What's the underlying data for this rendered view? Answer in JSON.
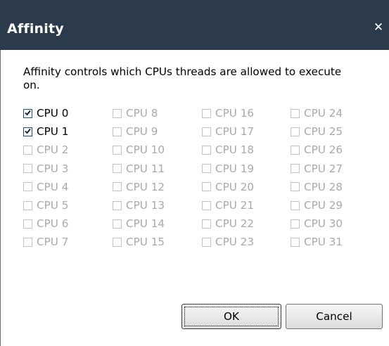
{
  "dialog": {
    "title": "Affinity",
    "close_icon": "close-icon",
    "description": "Affinity controls which CPUs threads are allowed to execute on.",
    "cpus": [
      {
        "label": "CPU 0",
        "checked": true,
        "enabled": true
      },
      {
        "label": "CPU 1",
        "checked": true,
        "enabled": true
      },
      {
        "label": "CPU 2",
        "checked": false,
        "enabled": false
      },
      {
        "label": "CPU 3",
        "checked": false,
        "enabled": false
      },
      {
        "label": "CPU 4",
        "checked": false,
        "enabled": false
      },
      {
        "label": "CPU 5",
        "checked": false,
        "enabled": false
      },
      {
        "label": "CPU 6",
        "checked": false,
        "enabled": false
      },
      {
        "label": "CPU 7",
        "checked": false,
        "enabled": false
      },
      {
        "label": "CPU 8",
        "checked": false,
        "enabled": false
      },
      {
        "label": "CPU 9",
        "checked": false,
        "enabled": false
      },
      {
        "label": "CPU 10",
        "checked": false,
        "enabled": false
      },
      {
        "label": "CPU 11",
        "checked": false,
        "enabled": false
      },
      {
        "label": "CPU 12",
        "checked": false,
        "enabled": false
      },
      {
        "label": "CPU 13",
        "checked": false,
        "enabled": false
      },
      {
        "label": "CPU 14",
        "checked": false,
        "enabled": false
      },
      {
        "label": "CPU 15",
        "checked": false,
        "enabled": false
      },
      {
        "label": "CPU 16",
        "checked": false,
        "enabled": false
      },
      {
        "label": "CPU 17",
        "checked": false,
        "enabled": false
      },
      {
        "label": "CPU 18",
        "checked": false,
        "enabled": false
      },
      {
        "label": "CPU 19",
        "checked": false,
        "enabled": false
      },
      {
        "label": "CPU 20",
        "checked": false,
        "enabled": false
      },
      {
        "label": "CPU 21",
        "checked": false,
        "enabled": false
      },
      {
        "label": "CPU 22",
        "checked": false,
        "enabled": false
      },
      {
        "label": "CPU 23",
        "checked": false,
        "enabled": false
      },
      {
        "label": "CPU 24",
        "checked": false,
        "enabled": false
      },
      {
        "label": "CPU 25",
        "checked": false,
        "enabled": false
      },
      {
        "label": "CPU 26",
        "checked": false,
        "enabled": false
      },
      {
        "label": "CPU 27",
        "checked": false,
        "enabled": false
      },
      {
        "label": "CPU 28",
        "checked": false,
        "enabled": false
      },
      {
        "label": "CPU 29",
        "checked": false,
        "enabled": false
      },
      {
        "label": "CPU 30",
        "checked": false,
        "enabled": false
      },
      {
        "label": "CPU 31",
        "checked": false,
        "enabled": false
      }
    ],
    "ok_label": "OK",
    "cancel_label": "Cancel",
    "colors": {
      "titlebar_bg": "#2b3b4c",
      "titlebar_text": "#ffffff",
      "enabled_text": "#000000",
      "disabled_text": "#a9a9a9"
    }
  }
}
